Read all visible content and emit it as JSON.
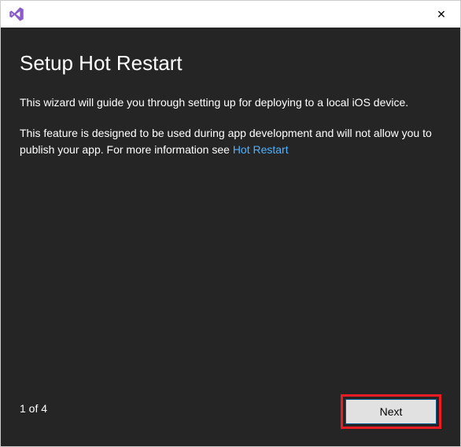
{
  "titlebar": {
    "close_glyph": "✕"
  },
  "content": {
    "heading": "Setup Hot Restart",
    "para1": "This wizard will guide you through setting up for deploying to a local iOS device.",
    "para2_before": "This feature is designed to be used during app development and will not allow you to publish your app. For more information see ",
    "para2_link": "Hot Restart"
  },
  "footer": {
    "step_counter": "1 of 4",
    "next_label": "Next"
  }
}
